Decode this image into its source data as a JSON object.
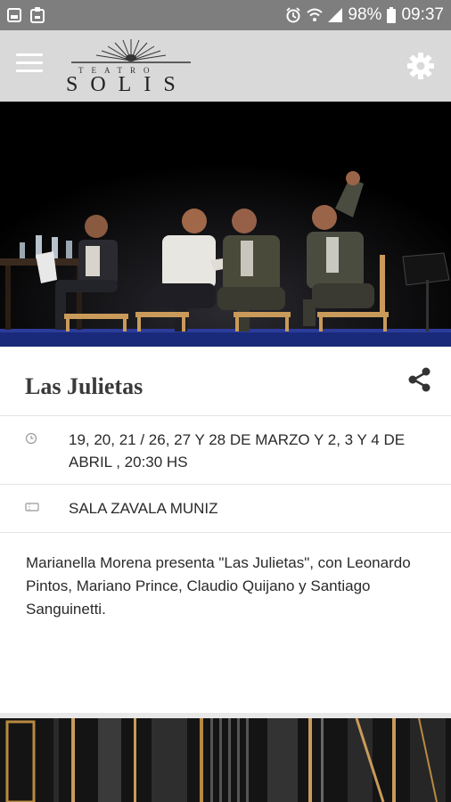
{
  "status_bar": {
    "battery_percent": "98%",
    "time": "09:37",
    "icons": [
      "gallery-icon",
      "clipboard-icon",
      "alarm-icon",
      "wifi-icon",
      "signal-icon",
      "battery-icon"
    ]
  },
  "app_bar": {
    "logo_small": "TEATRO",
    "logo_big": "SOLIS",
    "menu_icon": "hamburger-menu-icon",
    "settings_icon": "gear-icon"
  },
  "event": {
    "title": "Las Julietas",
    "date_text": "19, 20, 21 / 26, 27 Y 28 DE MARZO Y 2, 3 Y 4 DE ABRIL , 20:30 HS",
    "venue": "SALA ZAVALA MUNIZ",
    "description": "Marianella Morena presenta \"Las Julietas\", con Leonardo Pintos, Mariano Prince, Claudio Quijano y Santiago Sanguinetti."
  },
  "colors": {
    "status_bar": "#7e7e7e",
    "app_bar": "#d9d9d9",
    "divider": "#e4e4e4",
    "text": "#2a2a2a"
  }
}
